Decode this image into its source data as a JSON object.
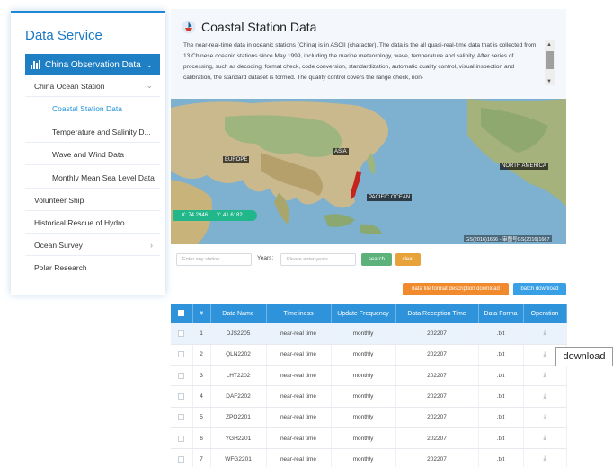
{
  "sidebar": {
    "title": "Data Service",
    "active_section": "China Observation Data",
    "items": [
      {
        "label": "China Ocean Station",
        "has_chevron": "down"
      },
      {
        "label": "Coastal Station Data",
        "sub": true,
        "current": true
      },
      {
        "label": "Temperature and Salinity D...",
        "sub": true
      },
      {
        "label": "Wave and Wind Data",
        "sub": true
      },
      {
        "label": "Monthly Mean Sea Level Data",
        "sub": true
      },
      {
        "label": "Volunteer Ship"
      },
      {
        "label": "Historical Rescue of Hydro..."
      },
      {
        "label": "Ocean Survey",
        "has_chevron": "right"
      },
      {
        "label": "Polar Research"
      }
    ]
  },
  "header": {
    "title": "Coastal Station Data",
    "description": "The near-real-time data in oceanic stations (China) is in ASCII (character). The data is the all quasi-real-time data that is collected from 13 Chinese oceanic stations since May 1999, including the marine meteorology, wave, temperature and salinity. After series of processing, such as decoding, format check, code conversion, standardization, automatic quality control, visual inspection and calibration, the standard dataset is formed. The quality control covers the range check, non-"
  },
  "map": {
    "labels": {
      "europe": "EUROPE",
      "asia": "ASIA",
      "north_america": "NORTH AMERICA",
      "pacific": "PACIFIC OCEAN"
    },
    "coord_x": "X: 74.2946",
    "coord_y": "Y: 41.6182",
    "attribution": "GS(2016)1666 - 审图号GS(2016)1667"
  },
  "search": {
    "station_placeholder": "Enter any station",
    "years_label": "Years:",
    "years_placeholder": "Please enter years",
    "search_label": "search",
    "clear_label": "clear"
  },
  "actions": {
    "format_doc_label": "data file format description download",
    "batch_label": "batch download"
  },
  "table": {
    "columns": [
      "",
      "#",
      "Data Name",
      "Timeliness",
      "Update Frequency",
      "Data Reception Time",
      "Data Forma",
      "Operation"
    ],
    "rows": [
      {
        "num": "1",
        "name": "DJS2205",
        "timeliness": "near-real time",
        "freq": "monthly",
        "time": "202207",
        "format": ".txt"
      },
      {
        "num": "2",
        "name": "QLN2202",
        "timeliness": "near-real time",
        "freq": "monthly",
        "time": "202207",
        "format": ".txt"
      },
      {
        "num": "3",
        "name": "LHT2202",
        "timeliness": "near-real time",
        "freq": "monthly",
        "time": "202207",
        "format": ".txt"
      },
      {
        "num": "4",
        "name": "DAF2202",
        "timeliness": "near-real time",
        "freq": "monthly",
        "time": "202207",
        "format": ".txt"
      },
      {
        "num": "5",
        "name": "ZPO2201",
        "timeliness": "near-real time",
        "freq": "monthly",
        "time": "202207",
        "format": ".txt"
      },
      {
        "num": "6",
        "name": "YGH2201",
        "timeliness": "near-real time",
        "freq": "monthly",
        "time": "202207",
        "format": ".txt"
      },
      {
        "num": "7",
        "name": "WFG2201",
        "timeliness": "near-real time",
        "freq": "monthly",
        "time": "202207",
        "format": ".txt"
      }
    ]
  },
  "tooltip": "download",
  "colors": {
    "accent": "#1f7fc4",
    "table_header": "#2e93da",
    "search_btn": "#5cb27a",
    "clear_btn": "#e8a23a",
    "format_btn": "#f08a2c",
    "batch_btn": "#3aa0e6"
  }
}
